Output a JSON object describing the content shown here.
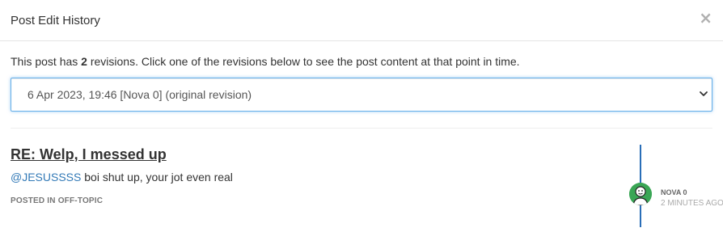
{
  "modal": {
    "title": "Post Edit History",
    "close_label": "×"
  },
  "intro": {
    "prefix": "This post has ",
    "count": "2",
    "suffix": " revisions. Click one of the revisions below to see the post content at that point in time."
  },
  "revision_select": {
    "selected": "6 Apr 2023, 19:46 [Nova 0] (original revision)"
  },
  "post": {
    "title": "RE: Welp, I messed up",
    "mention": "@JESUSSSS",
    "body_text": " boi shut up, your jot even real",
    "posted_in_prefix": "POSTED IN ",
    "category": "OFF-TOPIC"
  },
  "revision_author": {
    "name": "NOVA 0",
    "time": "2 MINUTES AGO"
  },
  "colors": {
    "timeline": "#2a6eb8",
    "avatar_bg": "#3aa655",
    "link": "#337ab7",
    "select_focus": "#66afe9"
  },
  "icons": {
    "close": "close-icon",
    "select": "chevron-down-icon",
    "avatar": "avatar"
  }
}
